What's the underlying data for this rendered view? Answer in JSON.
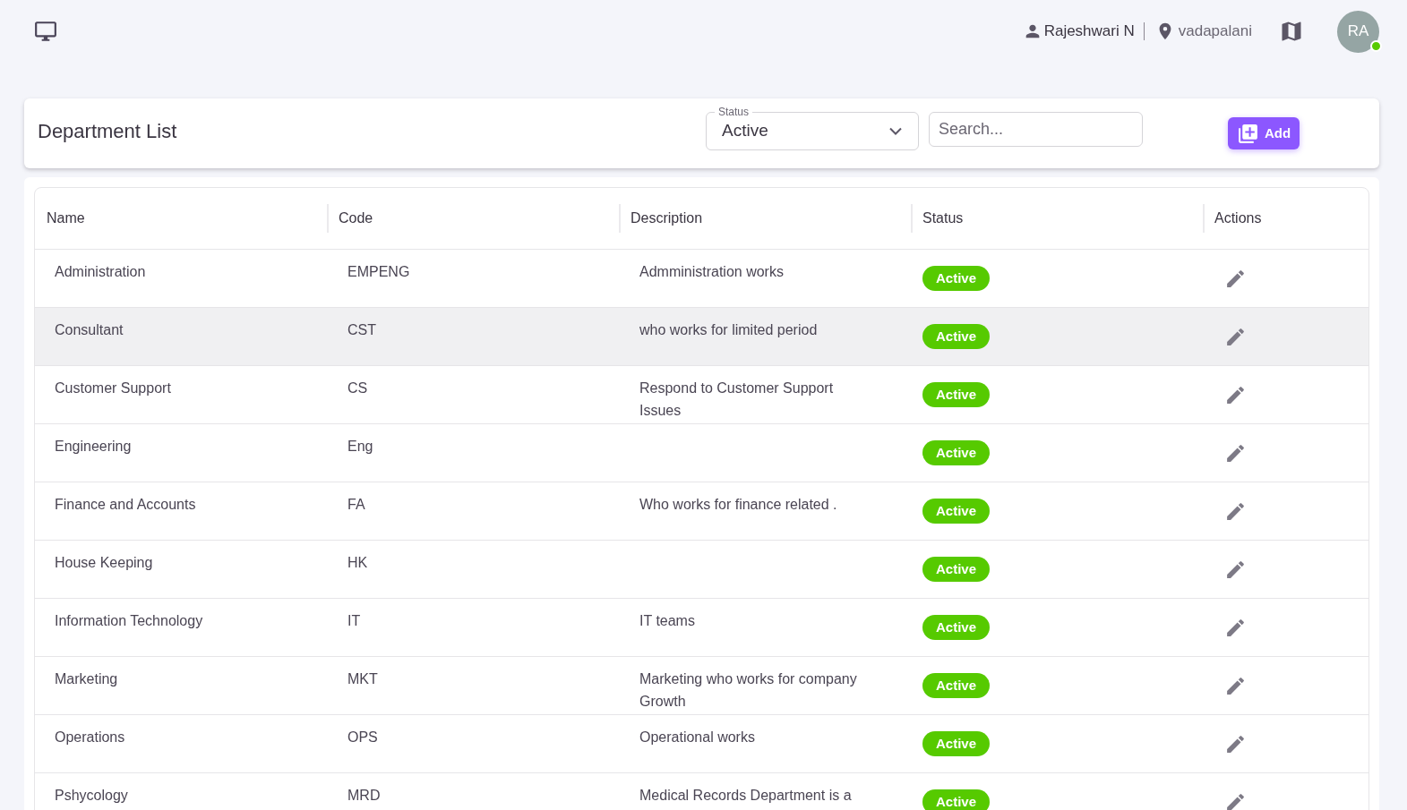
{
  "header": {
    "user_name": "Rajeshwari N",
    "location": "vadapalani",
    "avatar": {
      "initials": "RA",
      "online": true
    }
  },
  "page": {
    "title": "Department List",
    "status_filter": {
      "label": "Status",
      "value": "Active"
    },
    "search": {
      "placeholder": "Search..."
    },
    "add_button": "Add"
  },
  "table": {
    "columns": [
      "Name",
      "Code",
      "Description",
      "Status",
      "Actions"
    ],
    "rows": [
      {
        "name": "Administration",
        "code": "EMPENG",
        "description": "Admministration works",
        "status": "Active",
        "highlighted": false
      },
      {
        "name": "Consultant",
        "code": "CST",
        "description": "who works for limited period",
        "status": "Active",
        "highlighted": true
      },
      {
        "name": "Customer Support",
        "code": "CS",
        "description": "Respond to Customer Support Issues",
        "status": "Active",
        "highlighted": false
      },
      {
        "name": "Engineering",
        "code": "Eng",
        "status": "Active",
        "highlighted": false
      },
      {
        "name": "Finance and Accounts",
        "code": "FA",
        "description": "Who works for finance related .",
        "status": "Active",
        "highlighted": false
      },
      {
        "name": "House Keeping",
        "code": "HK",
        "status": "Active",
        "highlighted": false
      },
      {
        "name": "Information Technology",
        "code": "IT",
        "description": "IT teams",
        "status": "Active",
        "highlighted": false
      },
      {
        "name": "Marketing",
        "code": "MKT",
        "description": "Marketing who works for company Growth",
        "status": "Active",
        "highlighted": false
      },
      {
        "name": "Operations",
        "code": "OPS",
        "description": "Operational works",
        "status": "Active",
        "highlighted": false
      },
      {
        "name": "Pshycology",
        "code": "MRD",
        "description": "Medical Records Department is a",
        "status": "Active",
        "highlighted": false
      }
    ]
  }
}
